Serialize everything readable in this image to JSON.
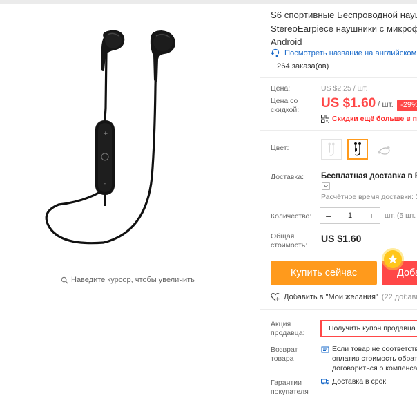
{
  "product": {
    "title_lines": [
      "S6 спортивные Беспроводной науш",
      "StereoEarpiece наушники с микрофо",
      "Android"
    ],
    "translate_link": "Посмотреть название на английском",
    "orders": "264 заказа(ов)",
    "zoom_hint": "Наведите курсор, чтобы увеличить"
  },
  "price": {
    "label": "Цена:",
    "old": "US $2.25 / шт.",
    "discount_label_line1": "Цена со",
    "discount_label_line2": "скидкой:",
    "current": "US $1.60",
    "unit": "/ шт.",
    "discount": "-29%",
    "qr_promo": "Скидки ещё больше в прил"
  },
  "color": {
    "label": "Цвет:",
    "options": [
      "white-earphones",
      "black-earphones",
      "silver-earphones"
    ],
    "selected": "black-earphones"
  },
  "shipping": {
    "label": "Доставка:",
    "main": "Бесплатная доставка в Rus",
    "sub": "Расчётное время доставки: 3"
  },
  "quantity": {
    "label": "Количество:",
    "value": "1",
    "minus": "–",
    "plus": "+",
    "note": "шт. (5 шт."
  },
  "total": {
    "label_line1": "Общая",
    "label_line2": "стоимость:",
    "value": "US $1.60"
  },
  "actions": {
    "buy_now": "Купить сейчас",
    "add_to_cart": "Доба",
    "wishlist": "Добавить в \"Мои желания\"",
    "wishlist_count": "(22 добавили"
  },
  "seller_promo": {
    "label_line1": "Акция",
    "label_line2": "продавца:",
    "coupon": "Получить купон продавца"
  },
  "returns": {
    "label_line1": "Возврат",
    "label_line2": "товара",
    "line1": "Если товар не соответств",
    "line2": "оплатив стоимость обрат",
    "line3": "договориться о компенса"
  },
  "guarantee": {
    "label_line1": "Гарантии",
    "label_line2": "покупателя",
    "line1": "Доставка в срок"
  },
  "colors": {
    "price_red": "#ff4747",
    "buy_orange": "#ff9a1c",
    "link_blue": "#1a6ac9"
  }
}
